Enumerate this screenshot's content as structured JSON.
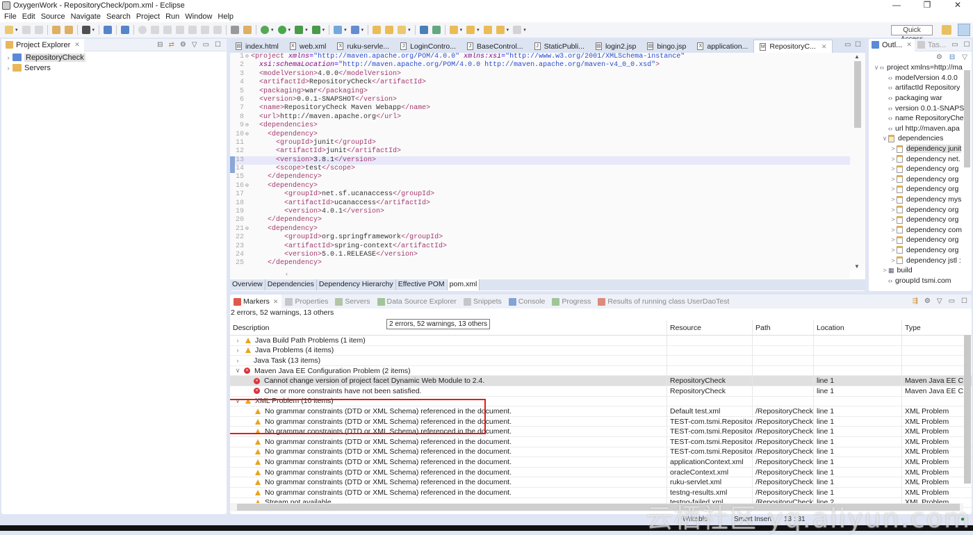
{
  "window": {
    "title": "OxygenWork - RepositoryCheck/pom.xml - Eclipse",
    "controls": [
      "—",
      "❐",
      "✕"
    ]
  },
  "menu": [
    "File",
    "Edit",
    "Source",
    "Navigate",
    "Search",
    "Project",
    "Run",
    "Window",
    "Help"
  ],
  "toolbar": {
    "quick_access": "Quick Access"
  },
  "project_explorer": {
    "title": "Project Explorer",
    "items": [
      {
        "label": "RepositoryCheck",
        "selected": true
      },
      {
        "label": "Servers",
        "selected": false
      }
    ]
  },
  "editor": {
    "tabs": [
      {
        "label": "index.html",
        "glyph": "▤"
      },
      {
        "label": "web.xml",
        "glyph": "X"
      },
      {
        "label": "ruku-servle...",
        "glyph": "X"
      },
      {
        "label": "LoginContro...",
        "glyph": "J"
      },
      {
        "label": "BaseControl...",
        "glyph": "J"
      },
      {
        "label": "StaticPubli...",
        "glyph": "J"
      },
      {
        "label": "login2.jsp",
        "glyph": "▤"
      },
      {
        "label": "bingo.jsp",
        "glyph": "▤"
      },
      {
        "label": "application...",
        "glyph": "X"
      },
      {
        "label": "RepositoryC...",
        "glyph": "M",
        "active": true
      }
    ],
    "lines": [
      {
        "n": "1",
        "fold": "⊖",
        "html": "<span class='tag'>&lt;project</span> <span class='attr'>xmlns</span>=<span class='str'>\"http://maven.apache.org/POM/4.0.0\"</span> <span class='attr'>xmlns:xsi</span>=<span class='str'>\"http://www.w3.org/2001/XMLSchema-instance\"</span>"
      },
      {
        "n": "2",
        "html": "  <span class='attr'>xsi:schemaLocation</span>=<span class='str'>\"http://maven.apache.org/POM/4.0.0 http://maven.apache.org/maven-v4_0_0.xsd\"</span><span class='tag'>&gt;</span>"
      },
      {
        "n": "3",
        "html": "  <span class='tag'>&lt;modelVersion&gt;</span><span class='txt'>4.0.0</span><span class='tag'>&lt;/modelVersion&gt;</span>"
      },
      {
        "n": "4",
        "html": "  <span class='tag'>&lt;artifactId&gt;</span><span class='txt'>RepositoryCheck</span><span class='tag'>&lt;/artifactId&gt;</span>"
      },
      {
        "n": "5",
        "html": "  <span class='tag'>&lt;packaging&gt;</span><span class='txt'>war</span><span class='tag'>&lt;/packaging&gt;</span>"
      },
      {
        "n": "6",
        "html": "  <span class='tag'>&lt;version&gt;</span><span class='txt'>0.0.1-SNAPSHOT</span><span class='tag'>&lt;/version&gt;</span>"
      },
      {
        "n": "7",
        "html": "  <span class='tag'>&lt;name&gt;</span><span class='txt'>RepositoryCheck Maven Webapp</span><span class='tag'>&lt;/name&gt;</span>"
      },
      {
        "n": "8",
        "html": "  <span class='tag'>&lt;url&gt;</span><span class='txt'>http://maven.apache.org</span><span class='tag'>&lt;/url&gt;</span>"
      },
      {
        "n": "9",
        "fold": "⊖",
        "html": "  <span class='tag'>&lt;dependencies&gt;</span>"
      },
      {
        "n": "10",
        "fold": "⊖",
        "html": "    <span class='tag'>&lt;dependency&gt;</span>"
      },
      {
        "n": "11",
        "html": "      <span class='tag'>&lt;groupId&gt;</span><span class='txt'>junit</span><span class='tag'>&lt;/groupId&gt;</span>"
      },
      {
        "n": "12",
        "html": "      <span class='tag'>&lt;artifactId&gt;</span><span class='txt'>junit</span><span class='tag'>&lt;/artifactId&gt;</span>"
      },
      {
        "n": "13",
        "hl": true,
        "mark": true,
        "html": "      <span class='tag'>&lt;version&gt;</span><span class='txt'>3.8.1</span><span class='tag'>&lt;/version&gt;</span>"
      },
      {
        "n": "14",
        "mark": true,
        "html": "      <span class='tag'>&lt;scope&gt;</span><span class='txt'>test</span><span class='tag'>&lt;/scope&gt;</span>"
      },
      {
        "n": "15",
        "html": "    <span class='tag'>&lt;/dependency&gt;</span>"
      },
      {
        "n": "16",
        "fold": "⊖",
        "html": "    <span class='tag'>&lt;dependency&gt;</span>"
      },
      {
        "n": "17",
        "html": "        <span class='tag'>&lt;groupId&gt;</span><span class='txt'>net.sf.ucanaccess</span><span class='tag'>&lt;/groupId&gt;</span>"
      },
      {
        "n": "18",
        "html": "        <span class='tag'>&lt;artifactId&gt;</span><span class='txt'>ucanaccess</span><span class='tag'>&lt;/artifactId&gt;</span>"
      },
      {
        "n": "19",
        "html": "        <span class='tag'>&lt;version&gt;</span><span class='txt'>4.0.1</span><span class='tag'>&lt;/version&gt;</span>"
      },
      {
        "n": "20",
        "html": "    <span class='tag'>&lt;/dependency&gt;</span>"
      },
      {
        "n": "21",
        "fold": "⊖",
        "html": "    <span class='tag'>&lt;dependency&gt;</span>"
      },
      {
        "n": "22",
        "html": "        <span class='tag'>&lt;groupId&gt;</span><span class='txt'>org.springframework</span><span class='tag'>&lt;/groupId&gt;</span>"
      },
      {
        "n": "23",
        "html": "        <span class='tag'>&lt;artifactId&gt;</span><span class='txt'>spring-context</span><span class='tag'>&lt;/artifactId&gt;</span>"
      },
      {
        "n": "24",
        "html": "        <span class='tag'>&lt;version&gt;</span><span class='txt'>5.0.1.RELEASE</span><span class='tag'>&lt;/version&gt;</span>"
      },
      {
        "n": "25",
        "html": "    <span class='tag'>&lt;/dependency&gt;</span>"
      }
    ],
    "bottom_tabs": [
      {
        "label": "Overview"
      },
      {
        "label": "Dependencies"
      },
      {
        "label": "Dependency Hierarchy"
      },
      {
        "label": "Effective POM"
      },
      {
        "label": "pom.xml",
        "active": true
      }
    ]
  },
  "outline": {
    "tab_outline": "Outl...",
    "tab_tasks": "Tas...",
    "items": [
      {
        "level": 0,
        "twisty": "∨",
        "icon": "<>",
        "label": "project xmlns=http://ma"
      },
      {
        "level": 1,
        "icon": "<>",
        "label": "modelVersion  4.0.0"
      },
      {
        "level": 1,
        "icon": "<>",
        "label": "artifactId  Repository"
      },
      {
        "level": 1,
        "icon": "<>",
        "label": "packaging  war"
      },
      {
        "level": 1,
        "icon": "<>",
        "label": "version  0.0.1-SNAPS"
      },
      {
        "level": 1,
        "icon": "<>",
        "label": "name  RepositoryChe"
      },
      {
        "level": 1,
        "icon": "<>",
        "label": "url  http://maven.apa"
      },
      {
        "level": 1,
        "twisty": "∨",
        "icon": "folder",
        "label": "dependencies"
      },
      {
        "level": 2,
        "twisty": ">",
        "icon": "dep",
        "label": "dependency  junit",
        "selected": true
      },
      {
        "level": 2,
        "twisty": ">",
        "icon": "dep",
        "label": "dependency  net."
      },
      {
        "level": 2,
        "twisty": ">",
        "icon": "dep",
        "label": "dependency  org"
      },
      {
        "level": 2,
        "twisty": ">",
        "icon": "dep",
        "label": "dependency  org"
      },
      {
        "level": 2,
        "twisty": ">",
        "icon": "dep",
        "label": "dependency  org"
      },
      {
        "level": 2,
        "twisty": ">",
        "icon": "dep",
        "label": "dependency  mys"
      },
      {
        "level": 2,
        "twisty": ">",
        "icon": "dep",
        "label": "dependency  org"
      },
      {
        "level": 2,
        "twisty": ">",
        "icon": "dep",
        "label": "dependency  org"
      },
      {
        "level": 2,
        "twisty": ">",
        "icon": "dep",
        "label": "dependency  com"
      },
      {
        "level": 2,
        "twisty": ">",
        "icon": "dep",
        "label": "dependency  org"
      },
      {
        "level": 2,
        "twisty": ">",
        "icon": "dep",
        "label": "dependency  org"
      },
      {
        "level": 2,
        "twisty": ">",
        "icon": "dep",
        "label": "dependency  jstl :"
      },
      {
        "level": 1,
        "twisty": ">",
        "icon": "build",
        "label": "build"
      },
      {
        "level": 1,
        "icon": "<>",
        "label": "groupId  tsmi.com"
      }
    ]
  },
  "markers": {
    "tabs": [
      {
        "label": "Markers",
        "active": true
      },
      {
        "label": "Properties"
      },
      {
        "label": "Servers"
      },
      {
        "label": "Data Source Explorer"
      },
      {
        "label": "Snippets"
      },
      {
        "label": "Console"
      },
      {
        "label": "Progress"
      },
      {
        "label": "Results of running class UserDaoTest"
      }
    ],
    "summary": "2 errors, 52 warnings, 13 others",
    "tooltip": "2 errors, 52 warnings, 13 others",
    "columns": [
      "Description",
      "Resource",
      "Path",
      "Location",
      "Type"
    ],
    "rows": [
      {
        "kind": "group",
        "expanded": false,
        "icon": "warning",
        "description": "Java Build Path Problems (1 item)",
        "resource": "",
        "path": "",
        "location": "",
        "type": ""
      },
      {
        "kind": "group",
        "expanded": false,
        "icon": "warning",
        "description": "Java Problems (4 items)",
        "resource": "",
        "path": "",
        "location": "",
        "type": ""
      },
      {
        "kind": "group",
        "expanded": false,
        "icon": "none",
        "description": "Java Task (13 items)",
        "resource": "",
        "path": "",
        "location": "",
        "type": ""
      },
      {
        "kind": "group",
        "expanded": true,
        "icon": "error",
        "description": "Maven Java EE Configuration Problem (2 items)",
        "resource": "",
        "path": "",
        "location": "",
        "type": ""
      },
      {
        "kind": "item",
        "icon": "error",
        "selected": true,
        "description": "Cannot change version of project facet Dynamic Web Module to 2.4.",
        "resource": "RepositoryCheck",
        "path": "",
        "location": "line 1",
        "type": "Maven Java EE Conf"
      },
      {
        "kind": "item",
        "icon": "error",
        "description": "One or more constraints have not been satisfied.",
        "resource": "RepositoryCheck",
        "path": "",
        "location": "line 1",
        "type": "Maven Java EE Conf"
      },
      {
        "kind": "group",
        "expanded": true,
        "icon": "warning",
        "description": "XML Problem (10 items)",
        "resource": "",
        "path": "",
        "location": "",
        "type": ""
      },
      {
        "kind": "item",
        "icon": "warning",
        "description": "No grammar constraints (DTD or XML Schema) referenced in the document.",
        "resource": "Default test.xml",
        "path": "/RepositoryCheck...",
        "location": "line 1",
        "type": "XML Problem"
      },
      {
        "kind": "item",
        "icon": "warning",
        "description": "No grammar constraints (DTD or XML Schema) referenced in the document.",
        "resource": "TEST-com.tsmi.Repository...",
        "path": "/RepositoryCheck...",
        "location": "line 1",
        "type": "XML Problem"
      },
      {
        "kind": "item",
        "icon": "warning",
        "description": "No grammar constraints (DTD or XML Schema) referenced in the document.",
        "resource": "TEST-com.tsmi.Repository...",
        "path": "/RepositoryCheck...",
        "location": "line 1",
        "type": "XML Problem"
      },
      {
        "kind": "item",
        "icon": "warning",
        "description": "No grammar constraints (DTD or XML Schema) referenced in the document.",
        "resource": "TEST-com.tsmi.Repository...",
        "path": "/RepositoryCheck...",
        "location": "line 1",
        "type": "XML Problem"
      },
      {
        "kind": "item",
        "icon": "warning",
        "description": "No grammar constraints (DTD or XML Schema) referenced in the document.",
        "resource": "TEST-com.tsmi.Repository...",
        "path": "/RepositoryCheck...",
        "location": "line 1",
        "type": "XML Problem"
      },
      {
        "kind": "item",
        "icon": "warning",
        "description": "No grammar constraints (DTD or XML Schema) referenced in the document.",
        "resource": "applicationContext.xml",
        "path": "/RepositoryCheck...",
        "location": "line 1",
        "type": "XML Problem"
      },
      {
        "kind": "item",
        "icon": "warning",
        "description": "No grammar constraints (DTD or XML Schema) referenced in the document.",
        "resource": "oracleContext.xml",
        "path": "/RepositoryCheck...",
        "location": "line 1",
        "type": "XML Problem"
      },
      {
        "kind": "item",
        "icon": "warning",
        "description": "No grammar constraints (DTD or XML Schema) referenced in the document.",
        "resource": "ruku-servlet.xml",
        "path": "/RepositoryCheck...",
        "location": "line 1",
        "type": "XML Problem"
      },
      {
        "kind": "item",
        "icon": "warning",
        "description": "No grammar constraints (DTD or XML Schema) referenced in the document.",
        "resource": "testng-results.xml",
        "path": "/RepositoryCheck...",
        "location": "line 1",
        "type": "XML Problem"
      },
      {
        "kind": "item",
        "icon": "warning",
        "description": "Stream not available",
        "resource": "testng-failed.xml",
        "path": "/RepositoryCheck...",
        "location": "line 2",
        "type": "XML Problem"
      }
    ]
  },
  "statusbar": {
    "writable": "Writable",
    "insert_mode": "Smart Insert",
    "position": "13 : 31"
  },
  "watermark": "云栖社区 yq.aliyun.com"
}
